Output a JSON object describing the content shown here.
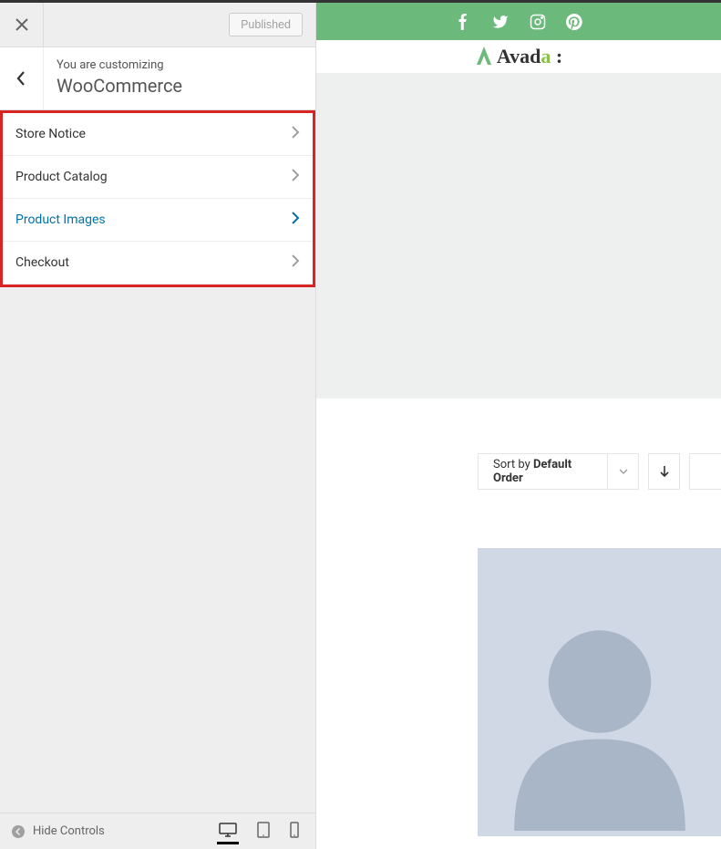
{
  "sidebar": {
    "published_label": "Published",
    "context_small": "You are customizing",
    "context_title": "WooCommerce",
    "items": [
      {
        "label": "Store Notice",
        "active": false
      },
      {
        "label": "Product Catalog",
        "active": false
      },
      {
        "label": "Product Images",
        "active": true
      },
      {
        "label": "Checkout",
        "active": false
      }
    ],
    "hide_controls": "Hide Controls"
  },
  "preview": {
    "brand": "Avada",
    "sort_prefix": "Sort by ",
    "sort_value": "Default Order"
  }
}
